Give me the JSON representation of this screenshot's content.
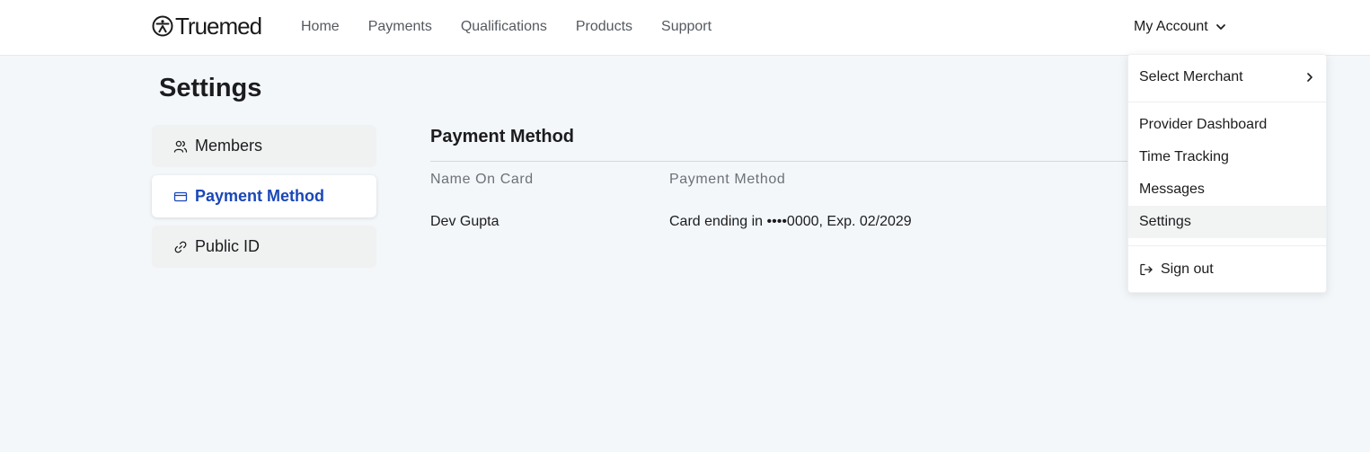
{
  "brand": {
    "name": "Truemed"
  },
  "nav": {
    "items": [
      {
        "label": "Home"
      },
      {
        "label": "Payments"
      },
      {
        "label": "Qualifications"
      },
      {
        "label": "Products"
      },
      {
        "label": "Support"
      }
    ],
    "account_label": "My Account"
  },
  "page": {
    "title": "Settings"
  },
  "sidebar": {
    "items": [
      {
        "label": "Members",
        "icon": "members-icon",
        "active": false
      },
      {
        "label": "Payment Method",
        "icon": "credit-card-icon",
        "active": true
      },
      {
        "label": "Public ID",
        "icon": "link-icon",
        "active": false
      }
    ]
  },
  "payment_method": {
    "title": "Payment Method",
    "columns": [
      "Name On Card",
      "Payment Method"
    ],
    "rows": [
      [
        "Dev Gupta",
        "Card ending in ••••0000, Exp. 02/2029"
      ]
    ]
  },
  "account_menu": {
    "select_merchant": "Select Merchant",
    "items": [
      {
        "label": "Provider Dashboard"
      },
      {
        "label": "Time Tracking"
      },
      {
        "label": "Messages"
      },
      {
        "label": "Settings",
        "highlighted": true
      }
    ],
    "sign_out": "Sign out"
  },
  "colors": {
    "accent": "#1a47b8",
    "page_bg": "#f3f7fa",
    "menu_highlight": "#f2f3f3"
  }
}
